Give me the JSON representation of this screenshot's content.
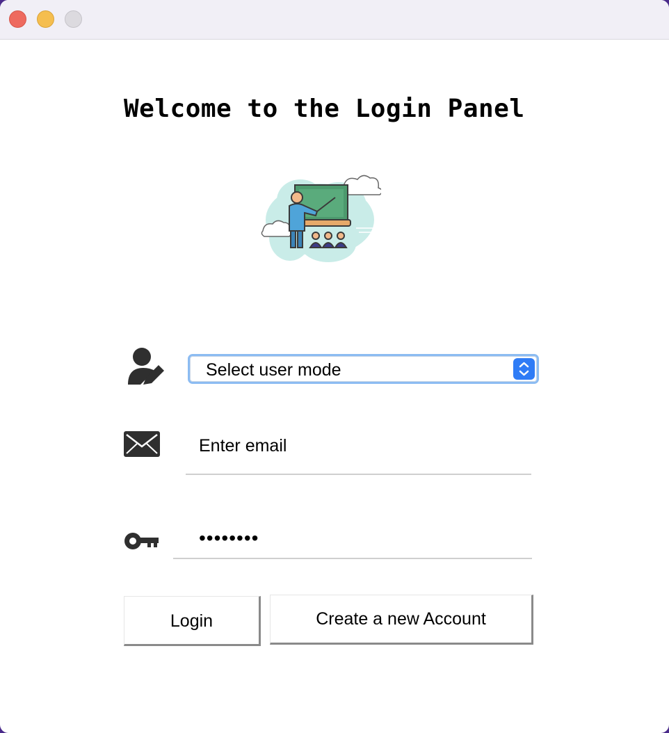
{
  "window": {
    "title": ""
  },
  "header": {
    "title": "Welcome to the Login Panel"
  },
  "illustration": {
    "icon": "teacher-classroom-icon"
  },
  "form": {
    "user_mode": {
      "selected": "Select user mode",
      "icon": "user-edit-icon"
    },
    "email": {
      "placeholder": "Enter email",
      "icon": "envelope-icon"
    },
    "password": {
      "value": "••••••••",
      "icon": "key-icon"
    }
  },
  "buttons": {
    "login_label": "Login",
    "create_account_label": "Create a new Account"
  },
  "colors": {
    "select_focus_ring": "#8cbcf2",
    "select_arrow_bg": "#2f7cf6",
    "titlebar_bg": "#f1eff6",
    "close": "#ee6a5f",
    "minimize": "#f5be4f",
    "zoom": "#dcdadf"
  }
}
